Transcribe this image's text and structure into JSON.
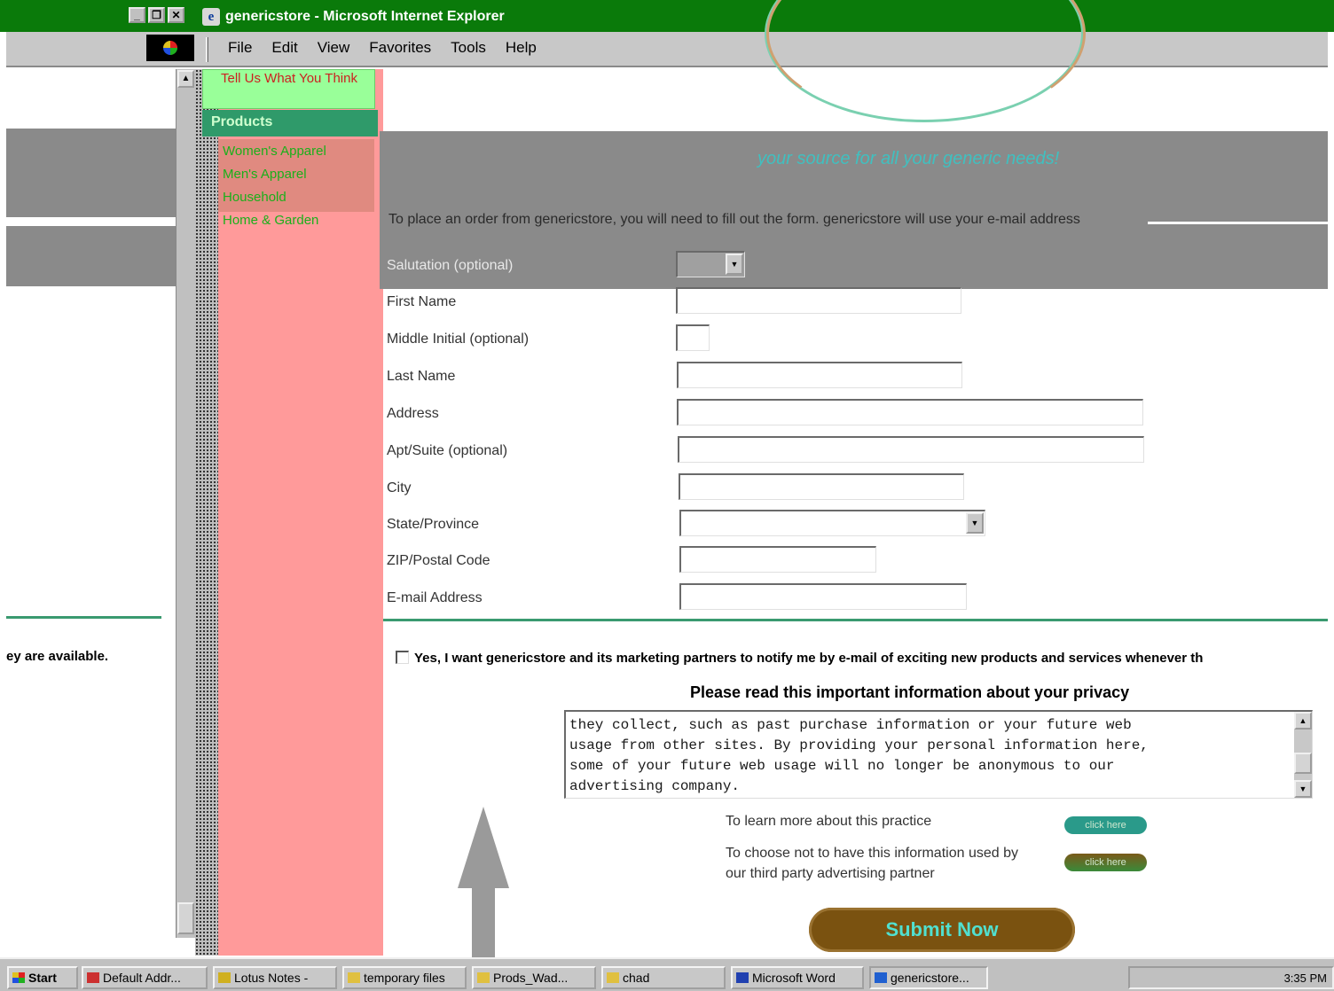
{
  "window": {
    "title": "genericstore - Microsoft Internet Explorer",
    "controls": [
      "_",
      "❐",
      "✕"
    ]
  },
  "menu": [
    "File",
    "Edit",
    "View",
    "Favorites",
    "Tools",
    "Help"
  ],
  "left_window": {
    "partial_text": "ey are available."
  },
  "nav": {
    "tell_us": "Tell Us What You Think",
    "products_heading": "Products",
    "items": [
      "Women's Apparel",
      "Men's Apparel",
      "Household",
      "Home & Garden"
    ]
  },
  "main": {
    "tagline": "your source for all your generic needs!",
    "notice": "To place an order from genericstore, you will need to fill out the form. genericstore will use your e-mail address",
    "form": {
      "salutation_label": "Salutation (optional)",
      "salutation_value": "",
      "first_name_label": "First Name",
      "middle_initial_label": "Middle Initial (optional)",
      "last_name_label": "Last Name",
      "address_label": "Address",
      "apt_label": "Apt/Suite (optional)",
      "city_label": "City",
      "state_label": "State/Province",
      "state_value": "",
      "zip_label": "ZIP/Postal Code",
      "email_label": "E-mail Address"
    },
    "consent_text": "Yes, I want genericstore and its marketing partners to notify me by e-mail of exciting new products and services whenever th",
    "privacy_heading": "Please read this important information about your privacy",
    "privacy_text": "they collect, such as past purchase information or your future web\nusage from other sites.  By providing your personal information here,\nsome of your future web usage will no longer be anonymous to our\nadvertising company.",
    "learn_more_text": "To learn more about this practice",
    "choose_not_text": "To choose not to have this information used by\nour third party advertising partner",
    "click_here_1": "click here",
    "click_here_2": "click here",
    "submit_label": "Submit Now"
  },
  "taskbar": {
    "start": "Start",
    "tasks": [
      "Default Addr...",
      "Lotus Notes -",
      "temporary files",
      "Prods_Wad...",
      "chad",
      "Microsoft Word",
      "genericstore..."
    ],
    "clock": "3:35 PM"
  },
  "colors": {
    "titlebar": "#0a7a0a",
    "nav_pink": "#ff9a9a",
    "products_green": "#2f9a6a",
    "tell_us_green": "#99ff99",
    "banner_grey": "#8a8a8a",
    "divider_green": "#3a9a70",
    "submit_brown": "#7a5210"
  }
}
